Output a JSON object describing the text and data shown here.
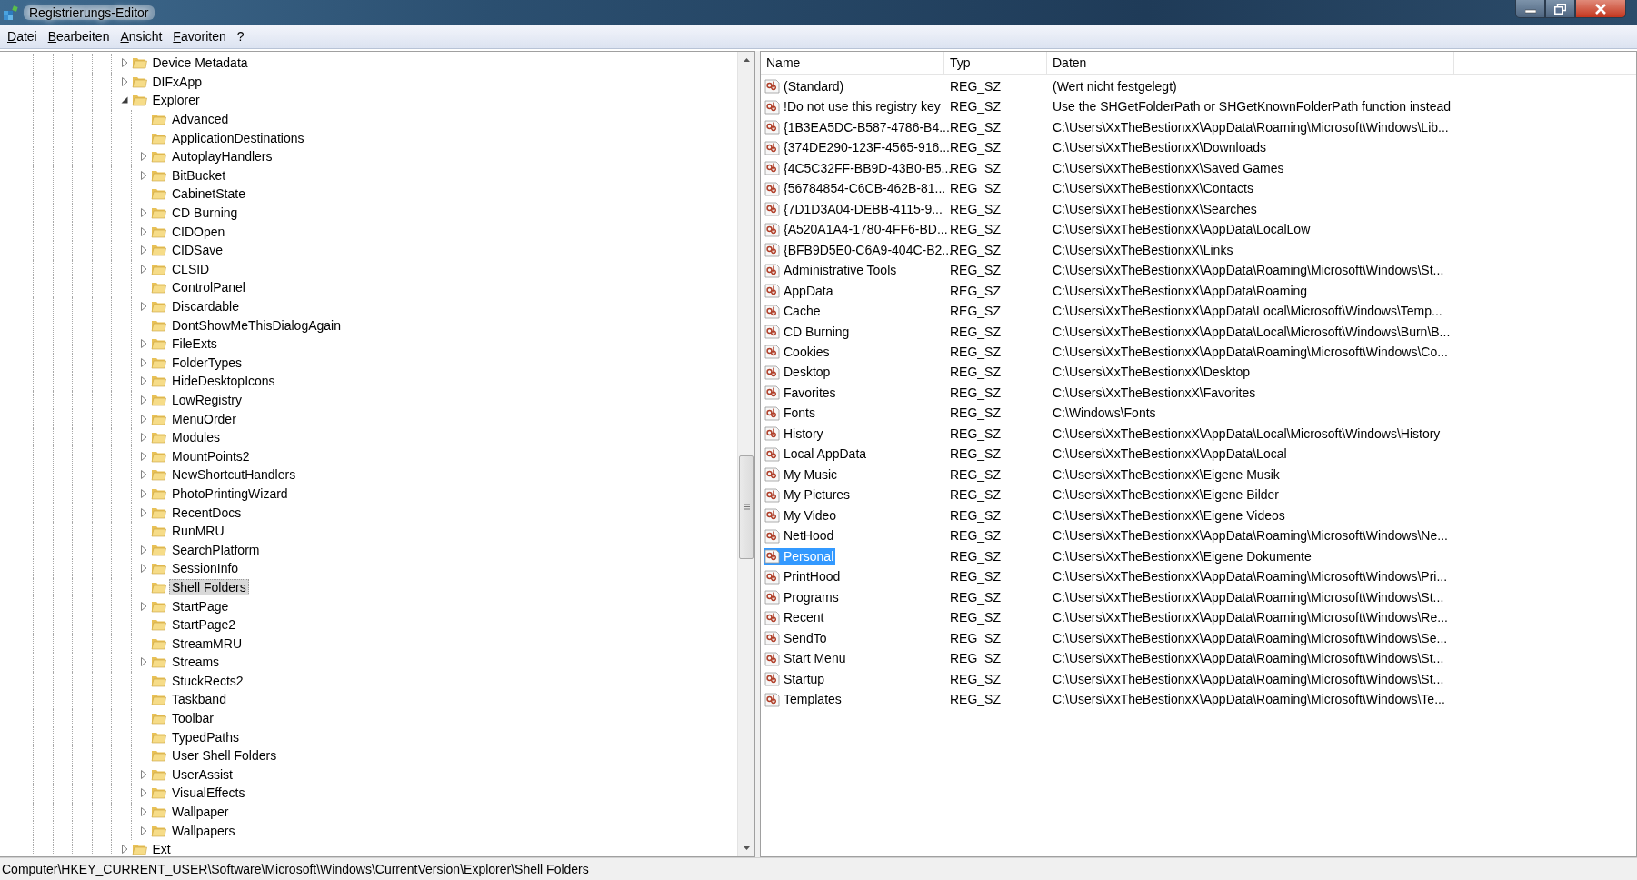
{
  "window": {
    "title": "Registrierungs-Editor"
  },
  "menu": [
    {
      "label": "Datei"
    },
    {
      "label": "Bearbeiten"
    },
    {
      "label": "Ansicht"
    },
    {
      "label": "Favoriten"
    },
    {
      "label": "?"
    }
  ],
  "tree": {
    "items": [
      {
        "label": "Device Metadata",
        "has_children": true,
        "expanded": false,
        "selected": false
      },
      {
        "label": "DIFxApp",
        "has_children": true,
        "expanded": false,
        "selected": false
      },
      {
        "label": "Explorer",
        "has_children": true,
        "expanded": true,
        "selected": false,
        "children": [
          {
            "label": "Advanced",
            "has_children": false,
            "selected": false
          },
          {
            "label": "ApplicationDestinations",
            "has_children": false,
            "selected": false
          },
          {
            "label": "AutoplayHandlers",
            "has_children": true,
            "expanded": false,
            "selected": false
          },
          {
            "label": "BitBucket",
            "has_children": true,
            "expanded": false,
            "selected": false
          },
          {
            "label": "CabinetState",
            "has_children": false,
            "selected": false
          },
          {
            "label": "CD Burning",
            "has_children": true,
            "expanded": false,
            "selected": false
          },
          {
            "label": "CIDOpen",
            "has_children": true,
            "expanded": false,
            "selected": false
          },
          {
            "label": "CIDSave",
            "has_children": true,
            "expanded": false,
            "selected": false
          },
          {
            "label": "CLSID",
            "has_children": true,
            "expanded": false,
            "selected": false
          },
          {
            "label": "ControlPanel",
            "has_children": false,
            "selected": false
          },
          {
            "label": "Discardable",
            "has_children": true,
            "expanded": false,
            "selected": false
          },
          {
            "label": "DontShowMeThisDialogAgain",
            "has_children": false,
            "selected": false
          },
          {
            "label": "FileExts",
            "has_children": true,
            "expanded": false,
            "selected": false
          },
          {
            "label": "FolderTypes",
            "has_children": true,
            "expanded": false,
            "selected": false
          },
          {
            "label": "HideDesktopIcons",
            "has_children": true,
            "expanded": false,
            "selected": false
          },
          {
            "label": "LowRegistry",
            "has_children": true,
            "expanded": false,
            "selected": false
          },
          {
            "label": "MenuOrder",
            "has_children": true,
            "expanded": false,
            "selected": false
          },
          {
            "label": "Modules",
            "has_children": true,
            "expanded": false,
            "selected": false
          },
          {
            "label": "MountPoints2",
            "has_children": true,
            "expanded": false,
            "selected": false
          },
          {
            "label": "NewShortcutHandlers",
            "has_children": true,
            "expanded": false,
            "selected": false
          },
          {
            "label": "PhotoPrintingWizard",
            "has_children": true,
            "expanded": false,
            "selected": false
          },
          {
            "label": "RecentDocs",
            "has_children": true,
            "expanded": false,
            "selected": false
          },
          {
            "label": "RunMRU",
            "has_children": false,
            "selected": false
          },
          {
            "label": "SearchPlatform",
            "has_children": true,
            "expanded": false,
            "selected": false
          },
          {
            "label": "SessionInfo",
            "has_children": true,
            "expanded": false,
            "selected": false
          },
          {
            "label": "Shell Folders",
            "has_children": false,
            "selected": true
          },
          {
            "label": "StartPage",
            "has_children": true,
            "expanded": false,
            "selected": false
          },
          {
            "label": "StartPage2",
            "has_children": false,
            "selected": false
          },
          {
            "label": "StreamMRU",
            "has_children": false,
            "selected": false
          },
          {
            "label": "Streams",
            "has_children": true,
            "expanded": false,
            "selected": false
          },
          {
            "label": "StuckRects2",
            "has_children": false,
            "selected": false
          },
          {
            "label": "Taskband",
            "has_children": false,
            "selected": false
          },
          {
            "label": "Toolbar",
            "has_children": false,
            "selected": false
          },
          {
            "label": "TypedPaths",
            "has_children": false,
            "selected": false
          },
          {
            "label": "User Shell Folders",
            "has_children": false,
            "selected": false
          },
          {
            "label": "UserAssist",
            "has_children": true,
            "expanded": false,
            "selected": false
          },
          {
            "label": "VisualEffects",
            "has_children": true,
            "expanded": false,
            "selected": false
          },
          {
            "label": "Wallpaper",
            "has_children": true,
            "expanded": false,
            "selected": false
          },
          {
            "label": "Wallpapers",
            "has_children": true,
            "expanded": false,
            "selected": false
          }
        ]
      },
      {
        "label": "Ext",
        "has_children": true,
        "expanded": false,
        "selected": false
      }
    ]
  },
  "values": {
    "columns": [
      {
        "label": "Name"
      },
      {
        "label": "Typ"
      },
      {
        "label": "Daten"
      }
    ],
    "rows": [
      {
        "name": "(Standard)",
        "type": "REG_SZ",
        "data": "(Wert nicht festgelegt)",
        "selected": false
      },
      {
        "name": "!Do not use this registry key",
        "type": "REG_SZ",
        "data": "Use the SHGetFolderPath or SHGetKnownFolderPath function instead",
        "selected": false
      },
      {
        "name": "{1B3EA5DC-B587-4786-B4...",
        "type": "REG_SZ",
        "data": "C:\\Users\\XxTheBestionxX\\AppData\\Roaming\\Microsoft\\Windows\\Lib...",
        "selected": false
      },
      {
        "name": "{374DE290-123F-4565-916...",
        "type": "REG_SZ",
        "data": "C:\\Users\\XxTheBestionxX\\Downloads",
        "selected": false
      },
      {
        "name": "{4C5C32FF-BB9D-43B0-B5...",
        "type": "REG_SZ",
        "data": "C:\\Users\\XxTheBestionxX\\Saved Games",
        "selected": false
      },
      {
        "name": "{56784854-C6CB-462B-81...",
        "type": "REG_SZ",
        "data": "C:\\Users\\XxTheBestionxX\\Contacts",
        "selected": false
      },
      {
        "name": "{7D1D3A04-DEBB-4115-9...",
        "type": "REG_SZ",
        "data": "C:\\Users\\XxTheBestionxX\\Searches",
        "selected": false
      },
      {
        "name": "{A520A1A4-1780-4FF6-BD...",
        "type": "REG_SZ",
        "data": "C:\\Users\\XxTheBestionxX\\AppData\\LocalLow",
        "selected": false
      },
      {
        "name": "{BFB9D5E0-C6A9-404C-B2...",
        "type": "REG_SZ",
        "data": "C:\\Users\\XxTheBestionxX\\Links",
        "selected": false
      },
      {
        "name": "Administrative Tools",
        "type": "REG_SZ",
        "data": "C:\\Users\\XxTheBestionxX\\AppData\\Roaming\\Microsoft\\Windows\\St...",
        "selected": false
      },
      {
        "name": "AppData",
        "type": "REG_SZ",
        "data": "C:\\Users\\XxTheBestionxX\\AppData\\Roaming",
        "selected": false
      },
      {
        "name": "Cache",
        "type": "REG_SZ",
        "data": "C:\\Users\\XxTheBestionxX\\AppData\\Local\\Microsoft\\Windows\\Temp...",
        "selected": false
      },
      {
        "name": "CD Burning",
        "type": "REG_SZ",
        "data": "C:\\Users\\XxTheBestionxX\\AppData\\Local\\Microsoft\\Windows\\Burn\\B...",
        "selected": false
      },
      {
        "name": "Cookies",
        "type": "REG_SZ",
        "data": "C:\\Users\\XxTheBestionxX\\AppData\\Roaming\\Microsoft\\Windows\\Co...",
        "selected": false
      },
      {
        "name": "Desktop",
        "type": "REG_SZ",
        "data": "C:\\Users\\XxTheBestionxX\\Desktop",
        "selected": false
      },
      {
        "name": "Favorites",
        "type": "REG_SZ",
        "data": "C:\\Users\\XxTheBestionxX\\Favorites",
        "selected": false
      },
      {
        "name": "Fonts",
        "type": "REG_SZ",
        "data": "C:\\Windows\\Fonts",
        "selected": false
      },
      {
        "name": "History",
        "type": "REG_SZ",
        "data": "C:\\Users\\XxTheBestionxX\\AppData\\Local\\Microsoft\\Windows\\History",
        "selected": false
      },
      {
        "name": "Local AppData",
        "type": "REG_SZ",
        "data": "C:\\Users\\XxTheBestionxX\\AppData\\Local",
        "selected": false
      },
      {
        "name": "My Music",
        "type": "REG_SZ",
        "data": "C:\\Users\\XxTheBestionxX\\Eigene Musik",
        "selected": false
      },
      {
        "name": "My Pictures",
        "type": "REG_SZ",
        "data": "C:\\Users\\XxTheBestionxX\\Eigene Bilder",
        "selected": false
      },
      {
        "name": "My Video",
        "type": "REG_SZ",
        "data": "C:\\Users\\XxTheBestionxX\\Eigene Videos",
        "selected": false
      },
      {
        "name": "NetHood",
        "type": "REG_SZ",
        "data": "C:\\Users\\XxTheBestionxX\\AppData\\Roaming\\Microsoft\\Windows\\Ne...",
        "selected": false
      },
      {
        "name": "Personal",
        "type": "REG_SZ",
        "data": "C:\\Users\\XxTheBestionxX\\Eigene Dokumente",
        "selected": true
      },
      {
        "name": "PrintHood",
        "type": "REG_SZ",
        "data": "C:\\Users\\XxTheBestionxX\\AppData\\Roaming\\Microsoft\\Windows\\Pri...",
        "selected": false
      },
      {
        "name": "Programs",
        "type": "REG_SZ",
        "data": "C:\\Users\\XxTheBestionxX\\AppData\\Roaming\\Microsoft\\Windows\\St...",
        "selected": false
      },
      {
        "name": "Recent",
        "type": "REG_SZ",
        "data": "C:\\Users\\XxTheBestionxX\\AppData\\Roaming\\Microsoft\\Windows\\Re...",
        "selected": false
      },
      {
        "name": "SendTo",
        "type": "REG_SZ",
        "data": "C:\\Users\\XxTheBestionxX\\AppData\\Roaming\\Microsoft\\Windows\\Se...",
        "selected": false
      },
      {
        "name": "Start Menu",
        "type": "REG_SZ",
        "data": "C:\\Users\\XxTheBestionxX\\AppData\\Roaming\\Microsoft\\Windows\\St...",
        "selected": false
      },
      {
        "name": "Startup",
        "type": "REG_SZ",
        "data": "C:\\Users\\XxTheBestionxX\\AppData\\Roaming\\Microsoft\\Windows\\St...",
        "selected": false
      },
      {
        "name": "Templates",
        "type": "REG_SZ",
        "data": "C:\\Users\\XxTheBestionxX\\AppData\\Roaming\\Microsoft\\Windows\\Te...",
        "selected": false
      }
    ]
  },
  "status_bar": {
    "path": "Computer\\HKEY_CURRENT_USER\\Software\\Microsoft\\Windows\\CurrentVersion\\Explorer\\Shell Folders"
  }
}
